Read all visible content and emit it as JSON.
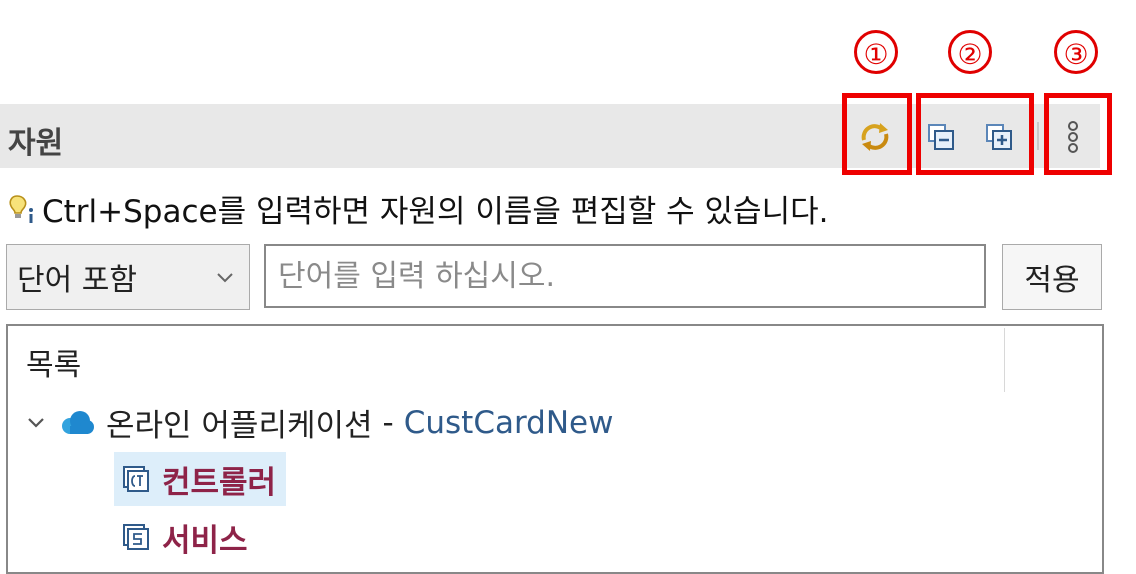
{
  "callouts": [
    "①",
    "②",
    "③"
  ],
  "view": {
    "title": "자원"
  },
  "toolbar": {
    "buttons": [
      {
        "icon": "sync-icon"
      },
      {
        "icon": "collapse-all-icon"
      },
      {
        "icon": "expand-all-icon"
      },
      {
        "icon": "more-vertical-icon"
      }
    ]
  },
  "hint": {
    "icon": "info-bulb-icon",
    "text": "Ctrl+Space를 입력하면 자원의 이름을 편집할 수 있습니다."
  },
  "filter": {
    "mode_selected": "단어 포함",
    "placeholder": "단어를 입력 하십시오.",
    "value": "",
    "apply_label": "적용"
  },
  "tree": {
    "header": "목록",
    "app": {
      "name": "온라인 어플리케이션",
      "separator": "-",
      "id": "CustCardNew",
      "expanded": true
    },
    "children": [
      {
        "label": "컨트롤러",
        "icon": "controller-icon",
        "selected": true
      },
      {
        "label": "서비스",
        "icon": "service-icon",
        "selected": false
      }
    ]
  },
  "colors": {
    "callout": "#e00000",
    "selection": "#ddeefa",
    "child_text": "#8e2348",
    "app_id": "#2f5a8a"
  }
}
